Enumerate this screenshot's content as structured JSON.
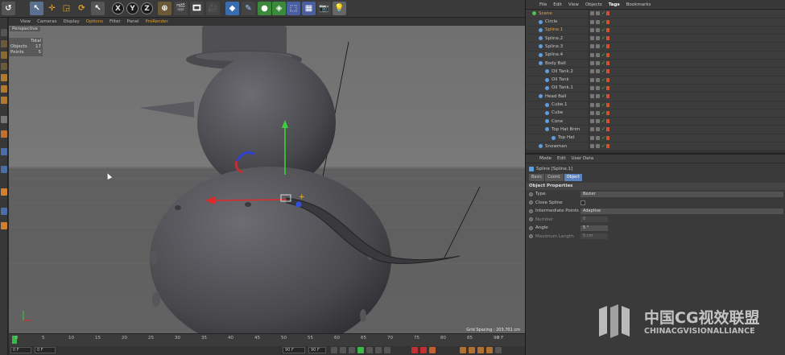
{
  "viewport": {
    "menu": [
      "View",
      "Cameras",
      "Display",
      "Options",
      "Filter",
      "Panel",
      "ProRender"
    ],
    "active_menu": "Options",
    "camera_label": "Perspective",
    "hud": {
      "header": "Total",
      "objects_label": "Objects",
      "objects_value": "17",
      "points_label": "Points",
      "points_value": "5"
    },
    "grid_spacing": "Grid Spacing : 203.701 cm"
  },
  "toolbar": {
    "axis_x": "X",
    "axis_y": "Y",
    "axis_z": "Z"
  },
  "timeline": {
    "ticks": [
      "0",
      "5",
      "10",
      "15",
      "20",
      "25",
      "30",
      "35",
      "40",
      "45",
      "50",
      "55",
      "60",
      "65",
      "70",
      "75",
      "80",
      "85",
      "90"
    ],
    "end_label": "0 F",
    "start_field": "0 F",
    "min_field": "0 F",
    "max_field": "90 F",
    "end_field": "90 F"
  },
  "object_manager": {
    "menu": [
      "File",
      "Edit",
      "View",
      "Objects",
      "Tags",
      "Bookmarks"
    ],
    "active_menu": "Tags",
    "objects": [
      {
        "name": "Scene",
        "indent": 0,
        "icon_color": "#4fc24f",
        "selected": true
      },
      {
        "name": "Circle",
        "indent": 1,
        "icon_color": "#5aa0e0",
        "selected": false
      },
      {
        "name": "Spline.1",
        "indent": 1,
        "icon_color": "#5aa0e0",
        "selected": true
      },
      {
        "name": "Spline.2",
        "indent": 1,
        "icon_color": "#5aa0e0",
        "selected": false
      },
      {
        "name": "Spline.3",
        "indent": 1,
        "icon_color": "#5aa0e0",
        "selected": false
      },
      {
        "name": "Spline.4",
        "indent": 1,
        "icon_color": "#5aa0e0",
        "selected": false
      },
      {
        "name": "Body Ball",
        "indent": 1,
        "icon_color": "#5aa0e0",
        "selected": false
      },
      {
        "name": "Oil Tank.2",
        "indent": 2,
        "icon_color": "#5aa0e0",
        "selected": false
      },
      {
        "name": "Oil Tank",
        "indent": 2,
        "icon_color": "#5aa0e0",
        "selected": false
      },
      {
        "name": "Oil Tank.1",
        "indent": 2,
        "icon_color": "#5aa0e0",
        "selected": false
      },
      {
        "name": "Head Ball",
        "indent": 1,
        "icon_color": "#5aa0e0",
        "selected": false
      },
      {
        "name": "Cube.1",
        "indent": 2,
        "icon_color": "#5aa0e0",
        "selected": false
      },
      {
        "name": "Cube",
        "indent": 2,
        "icon_color": "#5aa0e0",
        "selected": false
      },
      {
        "name": "Cone",
        "indent": 2,
        "icon_color": "#5aa0e0",
        "selected": false
      },
      {
        "name": "Top Hat Brim",
        "indent": 2,
        "icon_color": "#5aa0e0",
        "selected": false
      },
      {
        "name": "Top Hat",
        "indent": 3,
        "icon_color": "#5aa0e0",
        "selected": false
      },
      {
        "name": "Snowman",
        "indent": 1,
        "icon_color": "#5aa0e0",
        "selected": false
      }
    ]
  },
  "attributes": {
    "menu": [
      "Mode",
      "Edit",
      "User Data"
    ],
    "object_title": "Spline [Spline.1]",
    "tabs": [
      "Basic",
      "Coord.",
      "Object"
    ],
    "active_tab": "Object",
    "section": "Object Properties",
    "props": {
      "type_label": "Type",
      "type_value": "Bezier",
      "close_label": "Close Spline",
      "interp_label": "Intermediate Points",
      "interp_value": "Adaptive",
      "number_label": "Number",
      "number_value": "8",
      "angle_label": "Angle",
      "angle_value": "5 °",
      "maxlen_label": "Maximum Length",
      "maxlen_value": "5 cm"
    }
  },
  "watermark": {
    "cn": "中国CG视效联盟",
    "en": "CHINACGVISIONALLIANCE"
  },
  "colors": {
    "accent_blue": "#5c83bd",
    "selected_orange": "#e8a23a",
    "active_green": "#4fc24f"
  }
}
